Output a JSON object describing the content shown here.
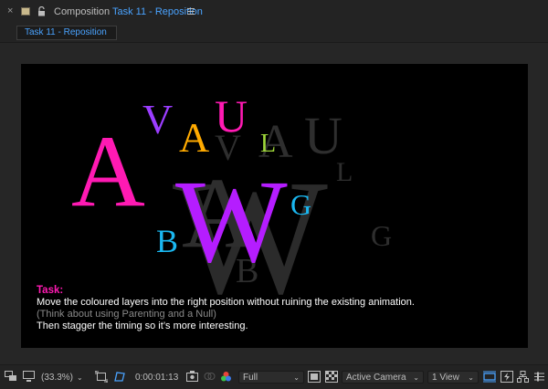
{
  "panel": {
    "close_glyph": "×",
    "title_prefix": "Composition",
    "comp_name": "Task 11 - Reposition",
    "tab_label": "Task 11 - Reposition"
  },
  "canvas": {
    "letters_colored": [
      {
        "char": "A",
        "color": "#ff1ab3"
      },
      {
        "char": "V",
        "color": "#9b3dff"
      },
      {
        "char": "A",
        "color": "#ffaa00"
      },
      {
        "char": "U",
        "color": "#ff1ab3"
      },
      {
        "char": "L",
        "color": "#9ed63a"
      },
      {
        "char": "W",
        "color": "#b51dff"
      },
      {
        "char": "G",
        "color": "#1ab7f0"
      },
      {
        "char": "B",
        "color": "#1ab7f0"
      }
    ],
    "letters_ghost": [
      {
        "char": "A",
        "color": "#2e2e2e"
      },
      {
        "char": "V",
        "color": "#2e2e2e"
      },
      {
        "char": "A",
        "color": "#2e2e2e"
      },
      {
        "char": "U",
        "color": "#2e2e2e"
      },
      {
        "char": "L",
        "color": "#2e2e2e"
      },
      {
        "char": "W",
        "color": "#2e2e2e"
      },
      {
        "char": "G",
        "color": "#2e2e2e"
      },
      {
        "char": "B",
        "color": "#2e2e2e"
      }
    ],
    "task_label": "Task:",
    "task_line1": "Move the coloured layers into the right position without ruining the existing animation.",
    "task_line2": "(Think about using Parenting and a Null)",
    "task_line3": "Then stagger the timing so it’s more interesting."
  },
  "toolbar": {
    "zoom": "(33.3%)",
    "timecode": "0:00:01:13",
    "resolution": "Full",
    "camera": "Active Camera",
    "view_layout": "1 View",
    "chevron": "⌄"
  },
  "colors": {
    "accent_blue": "#4aa3ff",
    "panel_bg": "#232323",
    "canvas_bg": "#000000"
  }
}
